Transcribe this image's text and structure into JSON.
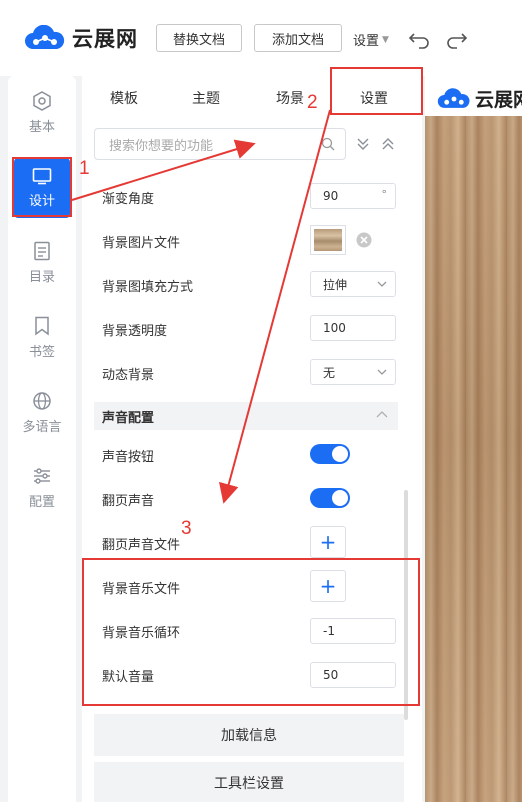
{
  "header": {
    "logo_text": "云展网",
    "replace_doc_button": "替换文档",
    "add_doc_button": "添加文档",
    "settings_menu": "设置"
  },
  "rail": {
    "items": [
      {
        "label": "基本",
        "icon": "hexagon-icon"
      },
      {
        "label": "设计",
        "icon": "monitor-icon"
      },
      {
        "label": "目录",
        "icon": "document-icon"
      },
      {
        "label": "书签",
        "icon": "bookmark-icon"
      },
      {
        "label": "多语言",
        "icon": "globe-icon"
      },
      {
        "label": "配置",
        "icon": "sliders-icon"
      }
    ],
    "active": "设计"
  },
  "tabs": [
    "模板",
    "主题",
    "场景",
    "设置"
  ],
  "active_tab": "设置",
  "search": {
    "placeholder": "搜索你想要的功能"
  },
  "settings": {
    "gradient_angle": {
      "label": "渐变角度",
      "value": "90",
      "unit": "°"
    },
    "bg_image_file": {
      "label": "背景图片文件"
    },
    "bg_fill_mode": {
      "label": "背景图填充方式",
      "value": "拉伸"
    },
    "bg_opacity": {
      "label": "背景透明度",
      "value": "100"
    },
    "dynamic_bg": {
      "label": "动态背景",
      "value": "无"
    }
  },
  "sound_section": {
    "title": "声音配置",
    "sound_button": {
      "label": "声音按钮",
      "on": true
    },
    "page_sound": {
      "label": "翻页声音",
      "on": true
    },
    "page_sound_file": {
      "label": "翻页声音文件"
    },
    "bg_music_file": {
      "label": "背景音乐文件"
    },
    "bg_music_loop": {
      "label": "背景音乐循环",
      "value": "-1"
    },
    "default_volume": {
      "label": "默认音量",
      "value": "50"
    }
  },
  "bottom_buttons": [
    "加载信息",
    "工具栏设置"
  ],
  "annotations": [
    "1",
    "2",
    "3"
  ],
  "colors": {
    "accent": "#1b6ef3",
    "annotation": "#e53935"
  }
}
